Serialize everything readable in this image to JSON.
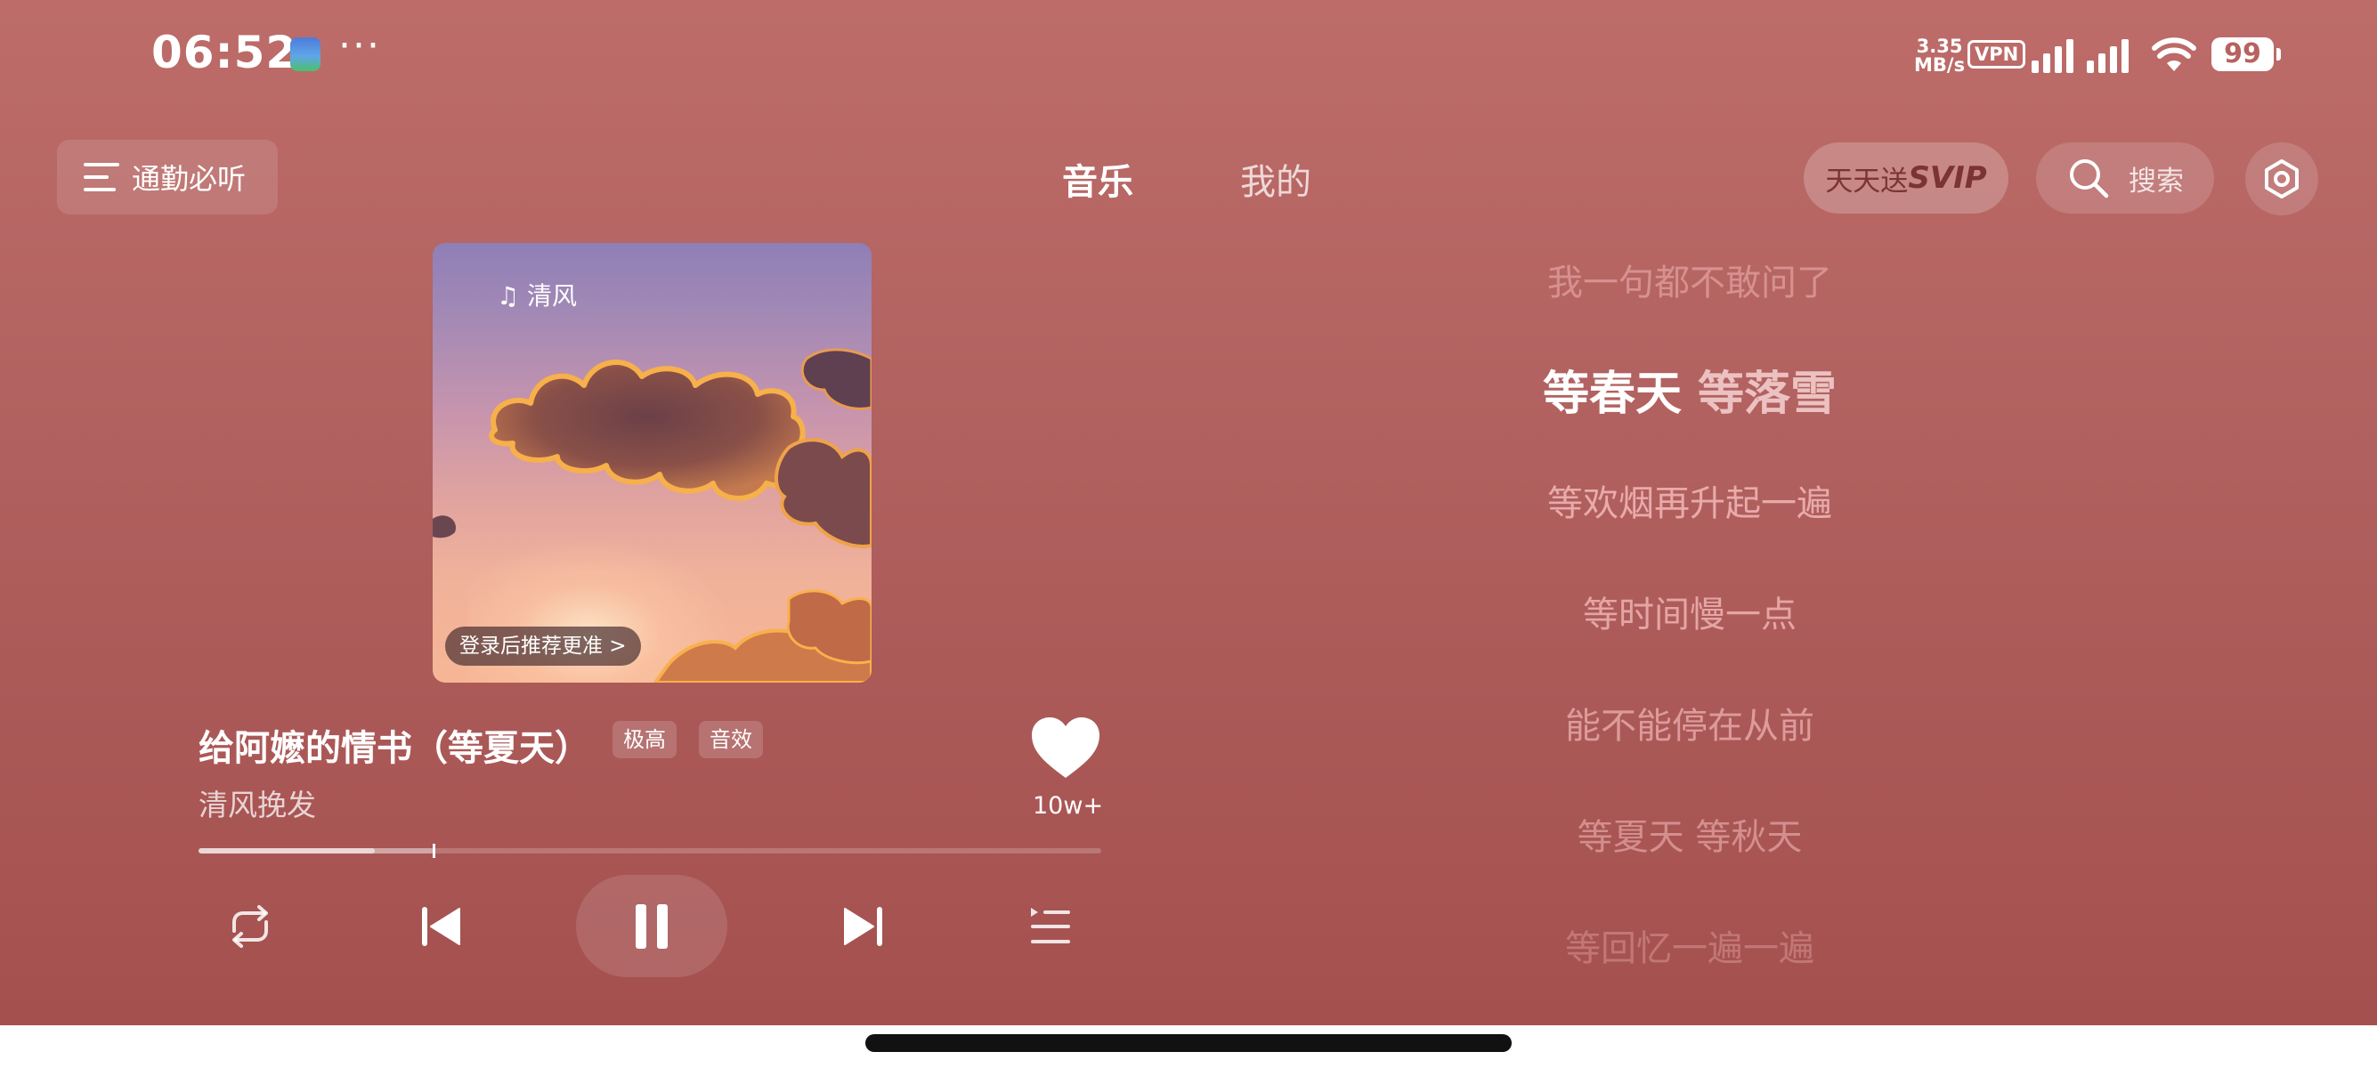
{
  "status_bar": {
    "time": "06:52",
    "more": "···",
    "net_speed_value": "3.35",
    "net_speed_unit": "MB/s",
    "vpn": "VPN",
    "battery": "99"
  },
  "header": {
    "playlist_label": "通勤必听",
    "tabs": [
      {
        "label": "音乐",
        "active": true
      },
      {
        "label": "我的",
        "active": false
      }
    ],
    "svip_prefix": "天天送",
    "svip_suffix": "SVIP",
    "search_label": "搜索"
  },
  "album": {
    "art_title": "♫ 清风",
    "login_prompt": "登录后推荐更准 >"
  },
  "song": {
    "title": "给阿嬷的情书（等夏天）",
    "quality_tag": "极高",
    "effect_tag": "音效",
    "artist": "清风挽发",
    "like_count": "10w+",
    "progress_fraction": 0.26,
    "buffered_fraction": 0.195
  },
  "lyrics": {
    "lines": [
      {
        "text": "我一句都不敢问了",
        "state": "past"
      },
      {
        "text": "等春天 等落雪",
        "state": "current",
        "sung": "等春天",
        "unsung": " 等落雪"
      },
      {
        "text": "等欢烟再升起一遍",
        "state": "upcoming"
      },
      {
        "text": "等时间慢一点",
        "state": "upcoming"
      },
      {
        "text": "能不能停在从前",
        "state": "upcoming"
      },
      {
        "text": "等夏天 等秋天",
        "state": "upcoming"
      },
      {
        "text": "等回忆一遍一遍",
        "state": "upcoming"
      }
    ]
  },
  "colors": {
    "background_top": "#bd6c69",
    "background_bottom": "#a4504f",
    "svip_text": "#7b3433"
  },
  "icons": [
    "menu-icon",
    "search-icon",
    "settings-icon",
    "heart-icon",
    "repeat-icon",
    "previous-icon",
    "pause-icon",
    "next-icon",
    "playlist-icon",
    "wifi-icon",
    "signal-icon"
  ]
}
